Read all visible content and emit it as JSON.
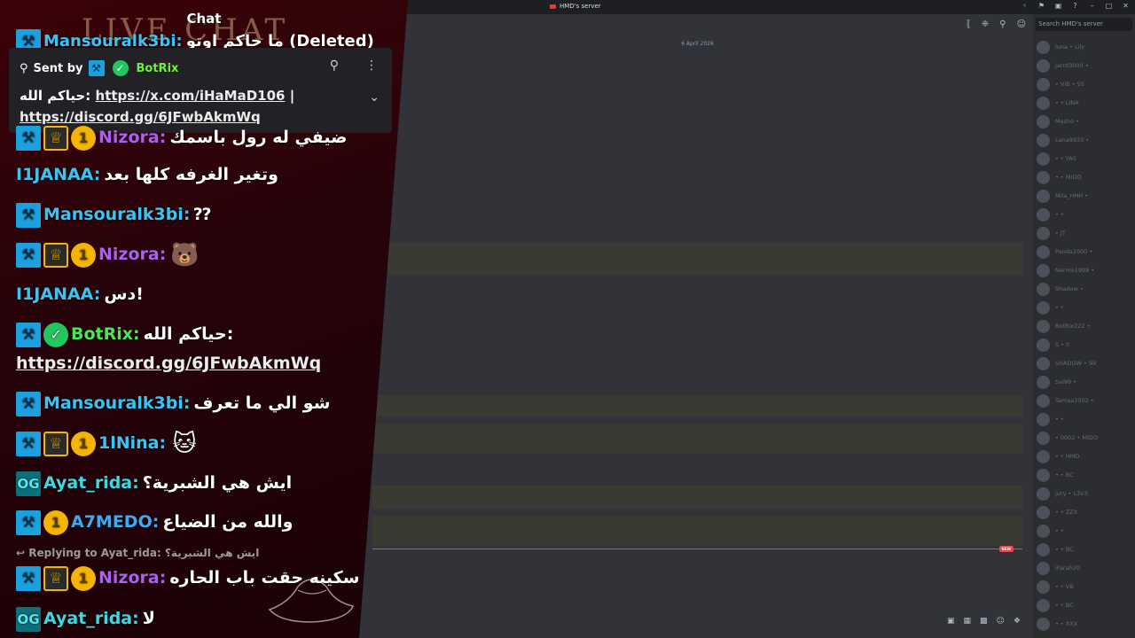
{
  "titlebar": {
    "server_title": "HMD's server"
  },
  "discord": {
    "search_placeholder": "Search HMD's server",
    "date_divider": "6 April 2026",
    "new_badge": "NEW",
    "members": [
      "luna • Lily",
      "Jarrd3000 •",
      "• VIB • 55",
      "• • LINA",
      "Mesho •",
      "Lana9933 •",
      "• • YAS",
      "• • MIDO",
      "Mila_HHH •",
      "• •",
      "• JT",
      "Panda1000 •",
      "Nermo1999 •",
      "Shadow •",
      "• •",
      "BotRix222 •",
      "S • S",
      "SHADOW • 99",
      "Sal99 •",
      "Tamaa1002 •",
      "• •",
      "• 0002 • MIDO",
      "• • HMD",
      "• • BC",
      "jury • L3V3",
      "• • ZZX",
      "• •",
      "• • BC",
      "iFarah20",
      "• • VB",
      "• • BC",
      "• • XXX"
    ]
  },
  "chat": {
    "header": "Chat",
    "deco_title": "LIVE CHAT",
    "pinned": {
      "sent_by": "Sent by",
      "user": "BotRix",
      "text_prefix": "حياكم الله:",
      "link1": "https://x.com/iHaMaD106",
      "sep": "|",
      "link2": "https://discord.gg/6JFwbAkmWq"
    },
    "messages": [
      {
        "user": "Mansouralk3bi:",
        "text": "ما حاكم اوتو",
        "deleted": "(Deleted)"
      },
      {
        "user": "Nizora:",
        "text": "ضيفي له رول باسمك"
      },
      {
        "user": "I1JANAA:",
        "text": "وتغير الغرفه كلها بعد"
      },
      {
        "user": "Mansouralk3bi:",
        "text": "⁇"
      },
      {
        "user": "Nizora:",
        "text": ""
      },
      {
        "user": "I1JANAA:",
        "text": "دس!"
      },
      {
        "user": "BotRix:",
        "text": "حياكم الله:",
        "link": "https://discord.gg/6JFwbAkmWq"
      },
      {
        "user": "Mansouralk3bi:",
        "text": "شو الي ما تعرف"
      },
      {
        "user": "1lNina:",
        "text": ""
      },
      {
        "user": "Ayat_rida:",
        "text": "ايش هي الشبرية؟"
      },
      {
        "user": "A7MEDO:",
        "text": "والله من الضياع"
      },
      {
        "user": "Nizora:",
        "text": "سكينه حقت باب الحاره"
      },
      {
        "user": "Ayat_rida:",
        "text": "لا"
      }
    ],
    "reply": {
      "label": "Replying to Ayat_rida:",
      "quote": "ايش هي الشبرية؟"
    },
    "coin_label": "1",
    "og_label": "OG"
  }
}
